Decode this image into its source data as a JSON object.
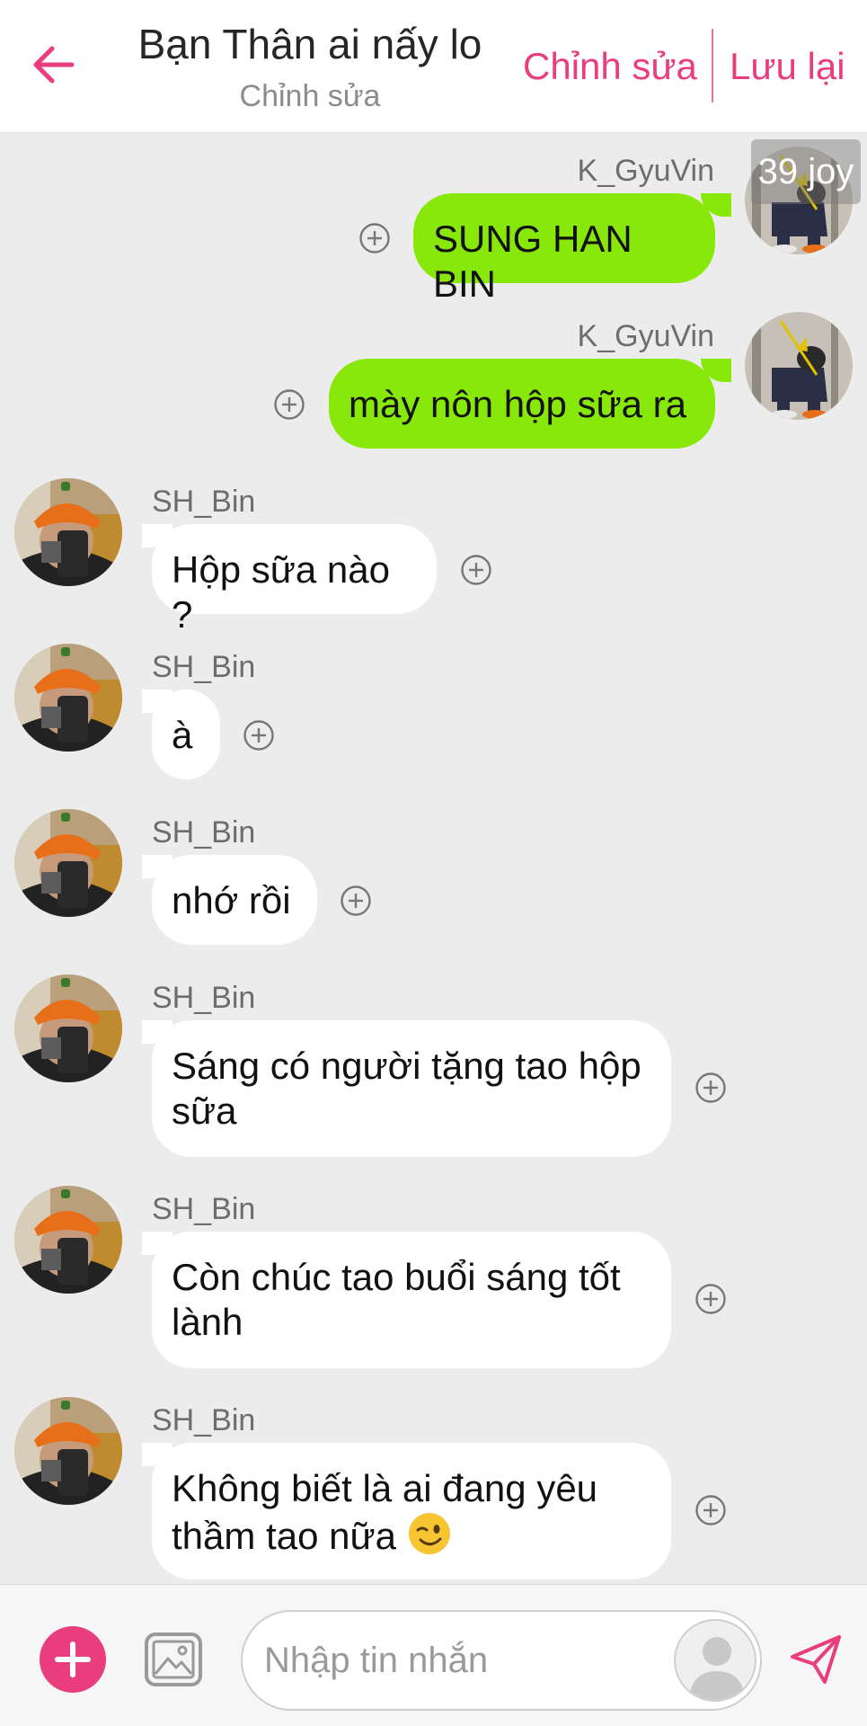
{
  "header": {
    "title": "Bạn Thân ai nấy lo",
    "subtitle": "Chỉnh sửa",
    "edit_label": "Chỉnh sửa",
    "save_label": "Lưu lại"
  },
  "overlay_badge": "39 joy",
  "messages": [
    {
      "sender": "K_GyuVin",
      "direction": "out",
      "text": "SUNG HAN BIN"
    },
    {
      "sender": "K_GyuVin",
      "direction": "out",
      "text": "mày nôn hộp sữa ra"
    },
    {
      "sender": "SH_Bin",
      "direction": "in",
      "text": "Hộp sữa nào ?"
    },
    {
      "sender": "SH_Bin",
      "direction": "in",
      "text": "à"
    },
    {
      "sender": "SH_Bin",
      "direction": "in",
      "text": "nhớ rồi"
    },
    {
      "sender": "SH_Bin",
      "direction": "in",
      "line1": "Sáng có người tặng tao hộp",
      "line2": "sữa"
    },
    {
      "sender": "SH_Bin",
      "direction": "in",
      "line1": "Còn chúc tao buổi sáng tốt",
      "line2": "lành"
    },
    {
      "sender": "SH_Bin",
      "direction": "in",
      "line1": "Không biết là ai đang yêu",
      "line2": "thầm tao nữa",
      "emoji": "winking-face"
    }
  ],
  "composer": {
    "placeholder": "Nhập tin nhắn"
  },
  "colors": {
    "accent": "#e93d7e",
    "outgoing_bubble": "#88e80a",
    "incoming_bubble": "#ffffff",
    "chat_background": "#ececec"
  },
  "icons": [
    "back-arrow-icon",
    "add-reaction-icon",
    "plus-icon",
    "image-icon",
    "user-placeholder-icon",
    "send-icon"
  ]
}
